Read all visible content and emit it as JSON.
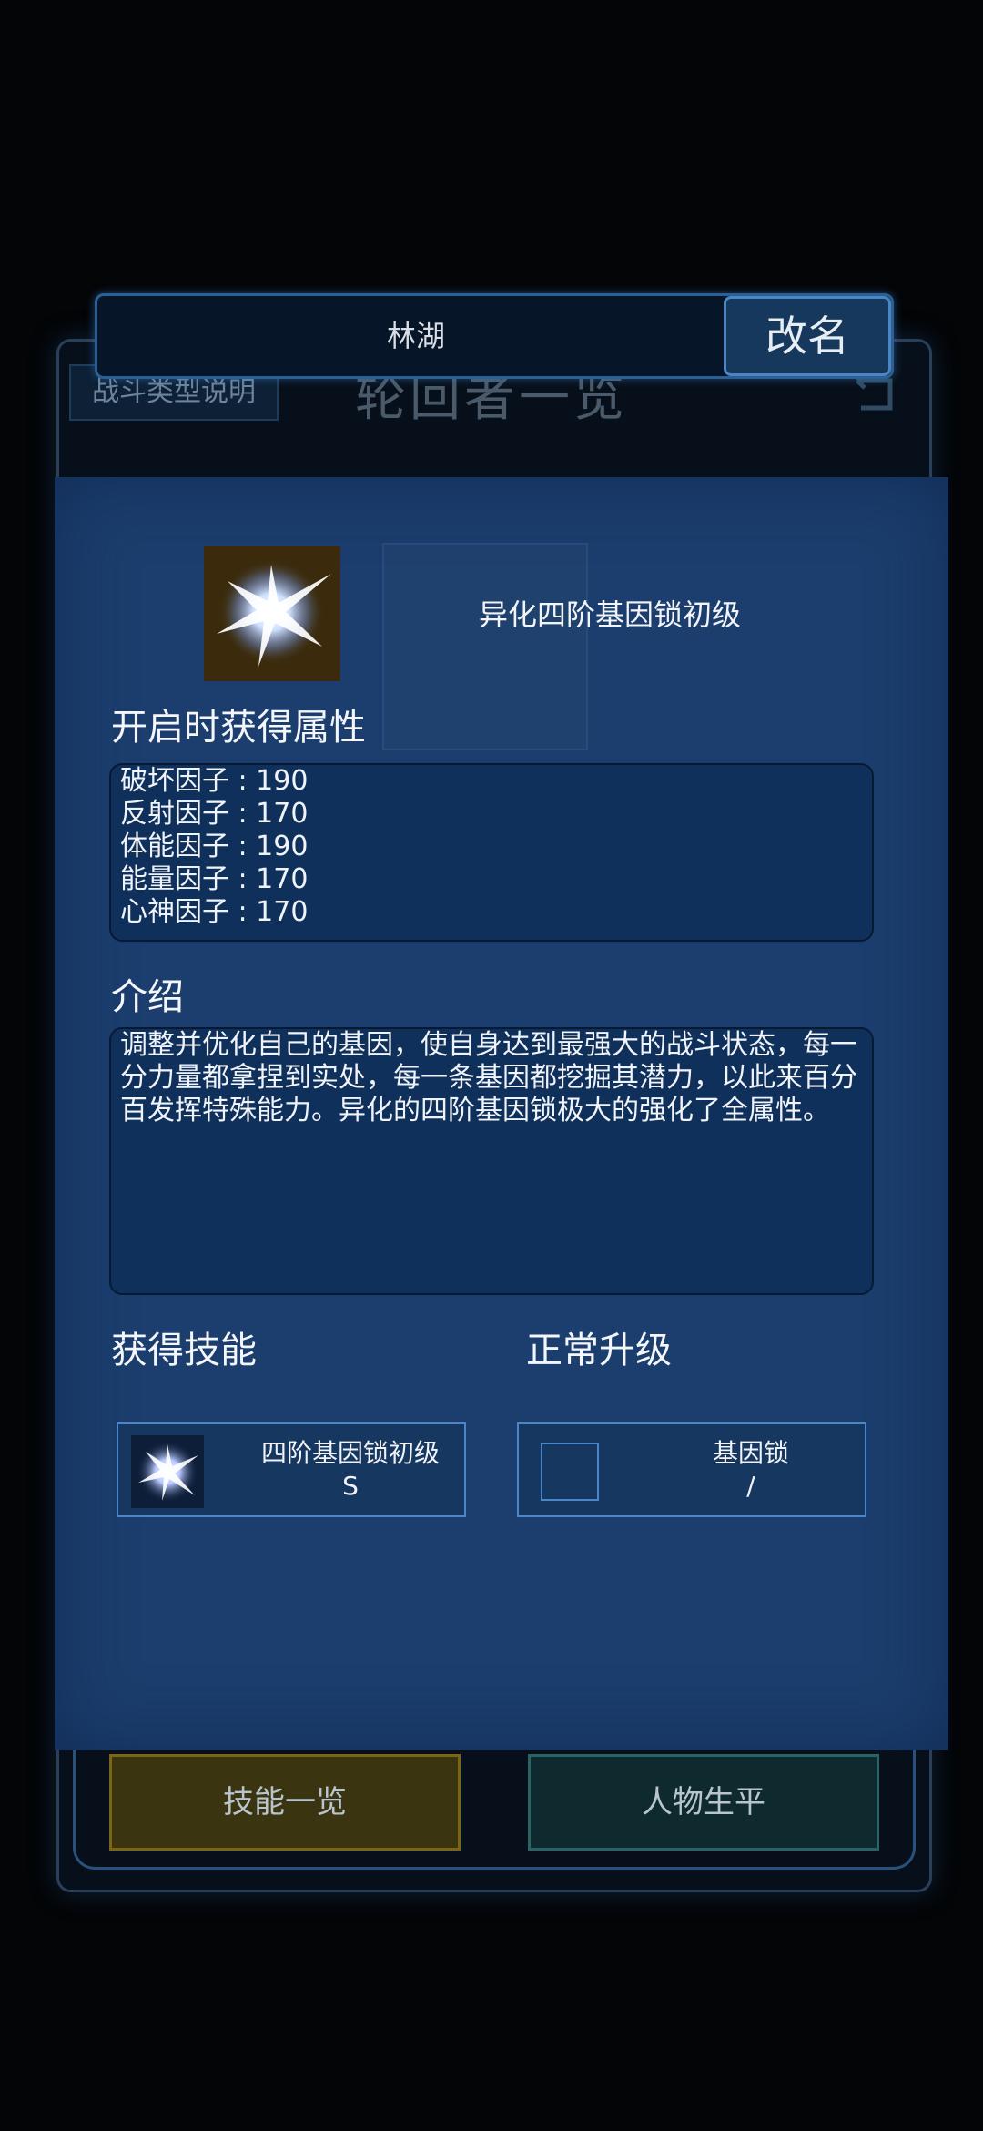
{
  "background": {
    "combat_type_label": "战斗类型说明",
    "page_title": "轮回者一览",
    "skills_button": "技能一览",
    "life_button": "人物生平"
  },
  "name_bar": {
    "name": "林湖",
    "rename_label": "改名"
  },
  "item": {
    "name": "异化四阶基因锁初级"
  },
  "attributes": {
    "title": "开启时获得属性",
    "lines": [
      "破坏因子 : 190",
      "反射因子 : 170",
      "体能因子 : 190",
      "能量因子 : 170",
      "心神因子 : 170"
    ]
  },
  "intro": {
    "title": "介绍",
    "text": "调整并优化自己的基因，使自身达到最强大的战斗状态，每一分力量都拿捏到实处，每一条基因都挖掘其潜力，以此来百分百发挥特殊能力。异化的四阶基因锁极大的强化了全属性。"
  },
  "gain_skill": {
    "title": "获得技能",
    "name": "四阶基因锁初级",
    "grade": "S"
  },
  "upgrade": {
    "title": "正常升级",
    "name": "基因锁",
    "grade": "/"
  }
}
